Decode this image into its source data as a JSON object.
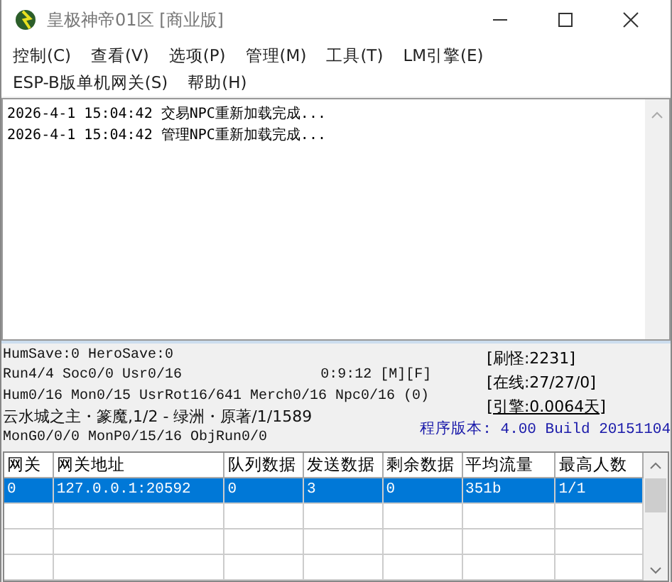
{
  "window": {
    "title": "皇极神帝01区 [商业版]"
  },
  "menu": [
    {
      "label": "控制(C)"
    },
    {
      "label": "查看(V)"
    },
    {
      "label": "选项(P)"
    },
    {
      "label": "管理(M)"
    },
    {
      "label": "工具(T)"
    },
    {
      "label": "LM引擎(E)"
    },
    {
      "label": "ESP-B版单机网关(S)"
    },
    {
      "label": "帮助(H)"
    }
  ],
  "log": [
    "2026-4-1 15:04:42 交易NPC重新加载完成...",
    "2026-4-1 15:04:42 管理NPC重新加载完成..."
  ],
  "status": {
    "lines": [
      {
        "text": "HumSave:0 HeroSave:0"
      },
      {
        "text": "Run4/4 Soc0/0 Usr0/16",
        "extra": "0:9:12 [M][F]"
      },
      {
        "text": "Hum0/16 Mon0/15 UsrRot16/641 Merch0/16 Npc0/16 (0)"
      },
      {
        "text": "云水城之主・篆魔,1/2 - 绿洲・原著/1/1589"
      },
      {
        "text": "MonG0/0/0 MonP0/15/16 ObjRun0/0"
      }
    ],
    "right": [
      {
        "text": "[刷怪:2231]",
        "link": false
      },
      {
        "text": "[在线:27/27/0]",
        "link": false
      },
      {
        "text": "[引擎:0.0064天]",
        "link": true
      }
    ],
    "version": "程序版本: 4.00 Build 20151104"
  },
  "table": {
    "columns": [
      "网关",
      "网关地址",
      "队列数据",
      "发送数据",
      "剩余数据",
      "平均流量",
      "最高人数"
    ],
    "rows": [
      {
        "cells": [
          "0",
          "127.0.0.1:20592",
          "0",
          "3",
          "0",
          "351b",
          "1/1"
        ],
        "selected": true
      }
    ]
  }
}
